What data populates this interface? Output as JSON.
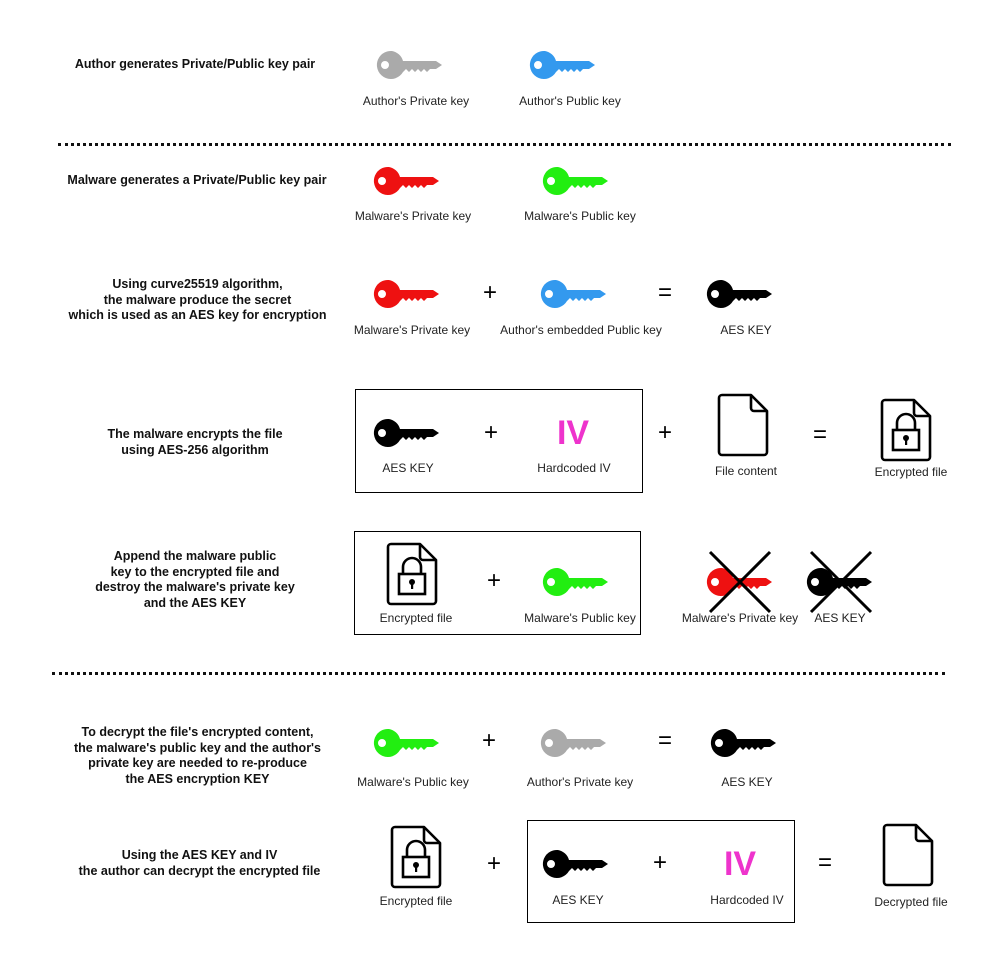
{
  "colors": {
    "author_private": "#aaaaaa",
    "author_public": "#3399ee",
    "malware_private": "#ee1111",
    "malware_public": "#22ee11",
    "aes": "#000000",
    "iv": "#ee33cc"
  },
  "steps": [
    {
      "text": "Author generates Private/Public key pair",
      "labels": [
        "Author's Private key",
        "Author's Public key"
      ]
    },
    {
      "text": "Malware generates a Private/Public key pair",
      "labels": [
        "Malware's Private key",
        "Malware's Public key"
      ]
    },
    {
      "text": "Using curve25519 algorithm,\nthe malware produce the secret\nwhich is used as an AES key for encryption",
      "labels": [
        "Malware's Private key",
        "Author's embedded Public key",
        "AES KEY"
      ]
    },
    {
      "text": "The malware encrypts the file\nusing AES-256 algorithm",
      "labels": [
        "AES KEY",
        "Hardcoded IV",
        "File content",
        "Encrypted file"
      ]
    },
    {
      "text": "Append the malware public\nkey to the encrypted file and\ndestroy the malware's private key\nand the AES KEY",
      "labels": [
        "Encrypted file",
        "Malware's Public key",
        "Malware's Private key",
        "AES KEY"
      ]
    },
    {
      "text": "To decrypt the file's encrypted content,\nthe malware's public key and the author's\nprivate key are needed to re-produce\nthe AES encryption KEY",
      "labels": [
        "Malware's Public key",
        "Author's Private key",
        "AES KEY"
      ]
    },
    {
      "text": "Using the AES KEY and IV\nthe author can decrypt the encrypted file",
      "labels": [
        "Encrypted file",
        "AES KEY",
        "Hardcoded IV",
        "Decrypted file"
      ]
    }
  ],
  "symbols": {
    "plus": "+",
    "equals": "=",
    "iv": "IV"
  }
}
